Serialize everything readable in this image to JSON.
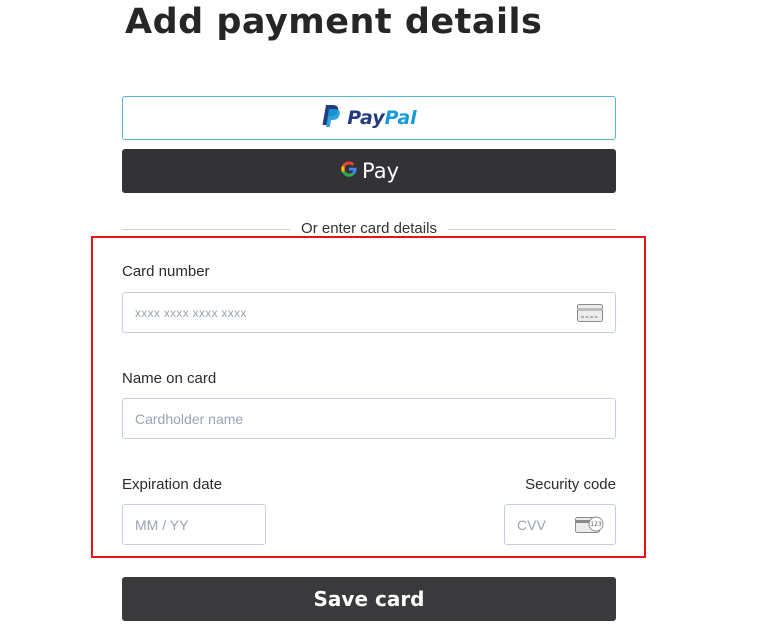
{
  "page": {
    "title": "Add payment details"
  },
  "wallets": {
    "paypal": {
      "word_pay": "Pay",
      "word_pal": "Pal"
    },
    "gpay": {
      "word": "Pay"
    }
  },
  "divider": {
    "text": "Or enter card details"
  },
  "form": {
    "card_number": {
      "label": "Card number",
      "placeholder": "xxxx xxxx xxxx xxxx",
      "value": ""
    },
    "name_on_card": {
      "label": "Name on card",
      "placeholder": "Cardholder name",
      "value": ""
    },
    "expiration": {
      "label": "Expiration date",
      "placeholder": "MM / YY",
      "value": ""
    },
    "security_code": {
      "label": "Security code",
      "placeholder": "CVV",
      "value": "",
      "icon_text": "123"
    }
  },
  "actions": {
    "save_label": "Save card"
  },
  "colors": {
    "highlight": "#e8121b",
    "paypal_dark": "#253b80",
    "paypal_light": "#179bd7",
    "button_dark": "#3a3a3d"
  },
  "icons": {
    "paypal": "paypal-logo-icon",
    "google": "google-g-icon",
    "card": "credit-card-icon",
    "cvv": "cvv-card-icon"
  }
}
